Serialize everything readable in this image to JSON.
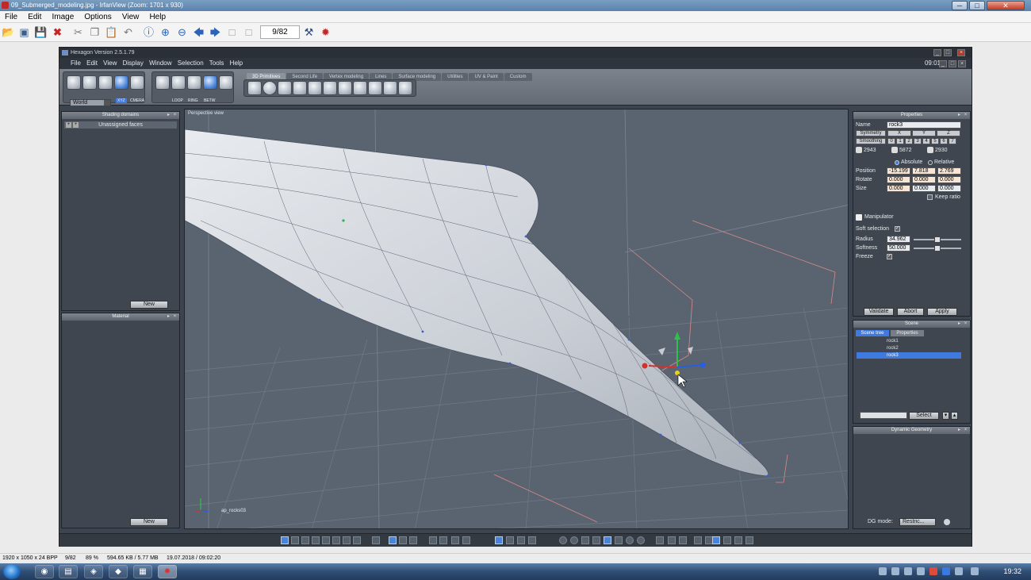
{
  "irfanview": {
    "title": "09_Submerged_modeling.jpg - IrfanView (Zoom: 1701 x 930)",
    "menu": [
      "File",
      "Edit",
      "Image",
      "Options",
      "View",
      "Help"
    ],
    "page_counter": "9/82",
    "window_buttons": [
      "─",
      "□",
      "✕"
    ],
    "status": {
      "dimensions": "1920 x 1050 x 24 BPP",
      "page": "9/82",
      "zoom": "89 %",
      "size": "594.65 KB / 5.77 MB",
      "datetime": "19.07.2018 / 09:02:20"
    }
  },
  "hexagon": {
    "title": "Hexagon Version 2.5.1.79",
    "menu": [
      "File",
      "Edit",
      "View",
      "Display",
      "Window",
      "Selection",
      "Tools",
      "Help"
    ],
    "time": "09:01",
    "tabs": [
      "3D Primitives",
      "Second Life",
      "Vertex modeling",
      "Lines",
      "Surface modeling",
      "Utilities",
      "UV & Paint",
      "Custom"
    ],
    "active_tab": "3D Primitives",
    "world_select": "World",
    "tool_labels": [
      "XYZ",
      "CMERA",
      "LOOP",
      "RING",
      "BETW"
    ],
    "viewport_label": "Perspective view",
    "viewport_object": "ap_rocks03",
    "shading_panel": {
      "title": "Shading domains",
      "item": "Unassigned faces",
      "new_button": "New"
    },
    "material_panel": {
      "title": "Material",
      "new_button": "New"
    },
    "properties": {
      "title": "Properties",
      "name_label": "Name",
      "name_value": "rock3",
      "symmetry_label": "Symmetry",
      "symmetry_axes": [
        "X",
        "Y",
        "Z"
      ],
      "smoothing_label": "Smoothing",
      "smoothing_levels": [
        "0",
        "1",
        "2",
        "3",
        "4",
        "5",
        "6",
        "7"
      ],
      "counts": [
        "2943",
        "5872",
        "2930"
      ],
      "absolute_label": "Absolute",
      "relative_label": "Relative",
      "position_label": "Position",
      "position": [
        "-15.199",
        "7.818",
        "2.769"
      ],
      "rotate_label": "Rotate",
      "rotate": [
        "0.000",
        "0.000",
        "0.000"
      ],
      "size_label": "Size",
      "size": [
        "0.000",
        "0.000",
        "0.000"
      ],
      "keep_ratio_label": "Keep ratio",
      "manipulator_label": "Manipulator",
      "soft_selection_label": "Soft selection",
      "radius_label": "Radius",
      "radius_value": "34.962",
      "radius_level": 0.5,
      "softness_label": "Softness",
      "softness_value": "50.000",
      "softness_level": 0.5,
      "freeze_label": "Freeze",
      "validate_button": "Validate",
      "abort_button": "Abort",
      "apply_button": "Apply"
    },
    "scene": {
      "title": "Scene",
      "tabs": [
        "Scene tree",
        "Properties"
      ],
      "items": [
        "rock1",
        "rock2",
        "rock3"
      ],
      "selected": "rock3",
      "select_button": "Select"
    },
    "dynamic_geometry": {
      "title": "Dynamic Geometry",
      "dg_mode_label": "DG mode:",
      "dg_mode_value": "Restric..."
    }
  },
  "taskbar": {
    "clock": "19:32"
  }
}
